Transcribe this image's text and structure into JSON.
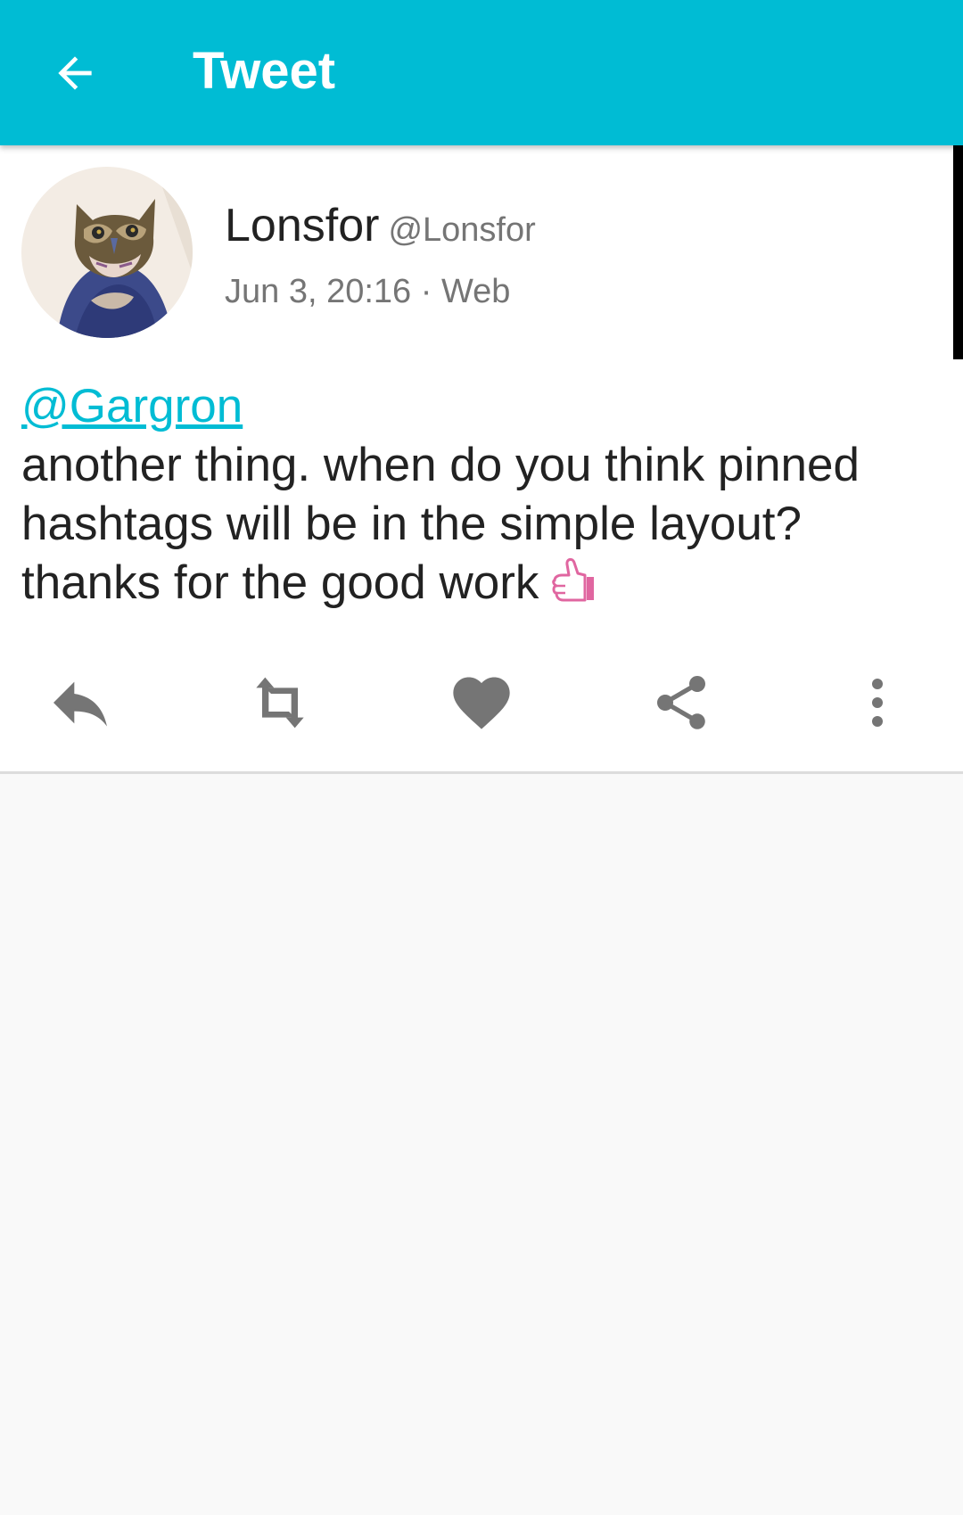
{
  "app_bar": {
    "title": "Tweet",
    "back_icon": "arrow-back-icon",
    "color": "#00bcd4"
  },
  "status": {
    "author": {
      "display_name": "Lonsfor",
      "handle": "@Lonsfor",
      "avatar_icon": "owl-avatar"
    },
    "timestamp": "Jun 3, 20:16",
    "separator": " · ",
    "source": "Web",
    "mention": "@Gargron",
    "body_lines": [
      "another thing. when do you think pinned",
      "hashtags will be in the simple layout?",
      "thanks for the good work"
    ],
    "emoji": "thumbs-up-icon"
  },
  "actions": [
    {
      "icon": "reply-icon"
    },
    {
      "icon": "retweet-icon"
    },
    {
      "icon": "heart-icon"
    },
    {
      "icon": "share-icon"
    },
    {
      "icon": "more-vertical-icon"
    }
  ],
  "colors": {
    "accent": "#00bcd4",
    "action_icon": "#757575",
    "emoji": "#e066a0"
  }
}
